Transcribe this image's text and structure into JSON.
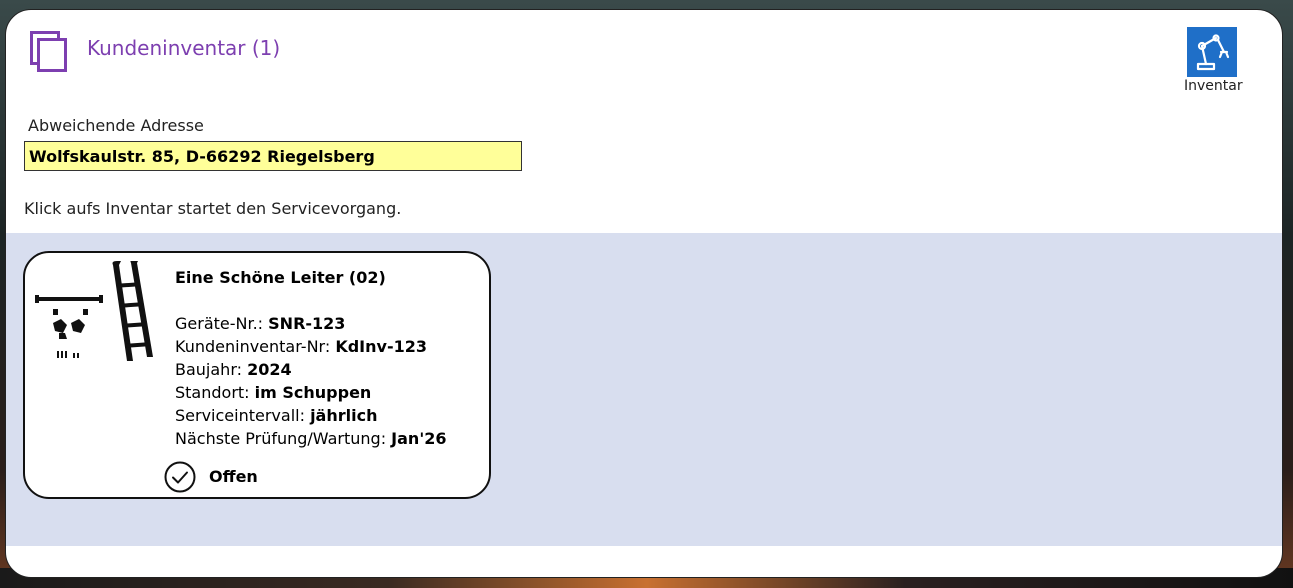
{
  "header": {
    "title": "Kundeninventar (1)",
    "inventar_button_label": "Inventar"
  },
  "address": {
    "label": "Abweichende Adresse",
    "value": "Wolfskaulstr. 85, D-66292 Riegelsberg"
  },
  "hint": "Klick aufs Inventar startet den Servicevorgang.",
  "items": [
    {
      "title": "Eine Schöne Leiter (02)",
      "geraete_label": "Geräte-Nr.: ",
      "geraete_value": "SNR-123",
      "kundeninv_label": "Kundeninventar-Nr: ",
      "kundeninv_value": "KdInv-123",
      "baujahr_label": "Baujahr: ",
      "baujahr_value": "2024",
      "standort_label": "Standort: ",
      "standort_value": "im Schuppen",
      "intervall_label": "Serviceintervall: ",
      "intervall_value": "jährlich",
      "pruefung_label": "Nächste Prüfung/Wartung: ",
      "pruefung_value": "Jan'26",
      "status": "Offen"
    }
  ],
  "colors": {
    "accent": "#7d3fb0",
    "button_blue": "#1f6fc8",
    "input_bg": "#ffff99",
    "list_bg": "#d8deef"
  },
  "icons": {
    "title": "stacked-pages-icon",
    "inventar": "robot-arm-icon",
    "status": "check-circle-icon"
  }
}
